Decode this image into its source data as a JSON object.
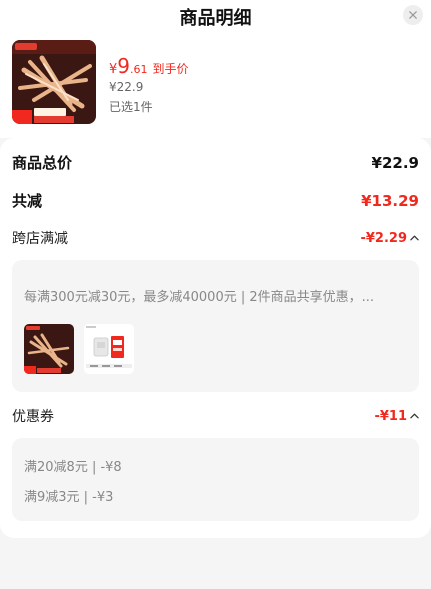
{
  "header": {
    "title": "商品明细"
  },
  "product": {
    "price_currency": "¥",
    "price_int": "9",
    "price_dec": ".61",
    "price_tag": "到手价",
    "original_price": "¥22.9",
    "selected_text": "已选1件"
  },
  "summary": {
    "total_label": "商品总价",
    "total_value": "¥22.9",
    "discount_label": "共减",
    "discount_value": "¥13.29"
  },
  "cross_store": {
    "label": "跨店满减",
    "value": "-¥2.29",
    "description": "每满300元减30元，最多减40000元 | 2件商品共享优惠，..."
  },
  "coupon": {
    "label": "优惠券",
    "value": "-¥11",
    "lines": [
      "满20减8元 | -¥8",
      "满9减3元 | -¥3"
    ]
  },
  "colors": {
    "accent": "#f0281e",
    "bg": "#f5f5f5"
  },
  "icons": [
    "close-icon",
    "chevron-up-icon",
    "product-thumbnail"
  ]
}
